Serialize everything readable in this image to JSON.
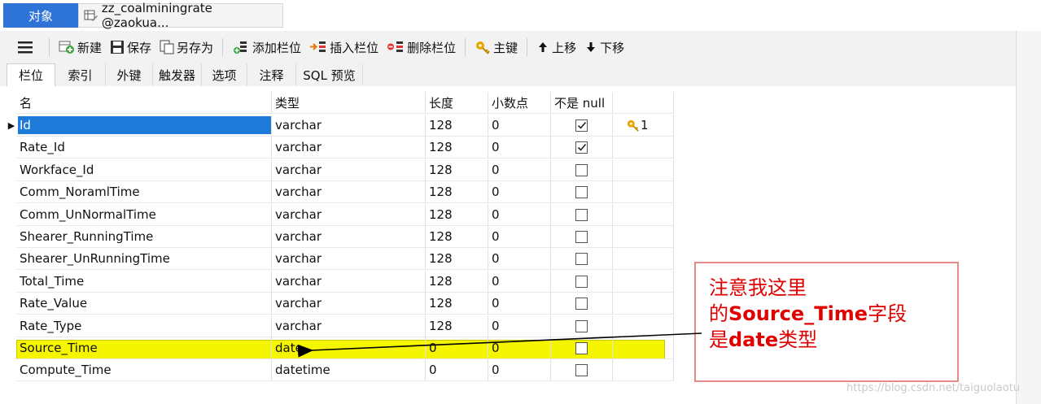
{
  "tabs": {
    "object": "对象",
    "table": "zz_coalminingrate @zaokua..."
  },
  "toolbar": {
    "new": "新建",
    "save": "保存",
    "save_as": "另存为",
    "add_field": "添加栏位",
    "insert_field": "插入栏位",
    "delete_field": "删除栏位",
    "primary_key": "主键",
    "move_up": "上移",
    "move_down": "下移"
  },
  "subtabs": [
    "栏位",
    "索引",
    "外键",
    "触发器",
    "选项",
    "注释",
    "SQL 预览"
  ],
  "columns": {
    "name": "名",
    "type": "类型",
    "length": "长度",
    "decimal": "小数点",
    "not_null": "不是 null"
  },
  "rows": [
    {
      "name": "Id",
      "type": "varchar",
      "length": "128",
      "decimal": "0",
      "not_null": true,
      "key": "1"
    },
    {
      "name": "Rate_Id",
      "type": "varchar",
      "length": "128",
      "decimal": "0",
      "not_null": true,
      "key": ""
    },
    {
      "name": "Workface_Id",
      "type": "varchar",
      "length": "128",
      "decimal": "0",
      "not_null": false,
      "key": ""
    },
    {
      "name": "Comm_NoramlTime",
      "type": "varchar",
      "length": "128",
      "decimal": "0",
      "not_null": false,
      "key": ""
    },
    {
      "name": "Comm_UnNormalTime",
      "type": "varchar",
      "length": "128",
      "decimal": "0",
      "not_null": false,
      "key": ""
    },
    {
      "name": "Shearer_RunningTime",
      "type": "varchar",
      "length": "128",
      "decimal": "0",
      "not_null": false,
      "key": ""
    },
    {
      "name": "Shearer_UnRunningTime",
      "type": "varchar",
      "length": "128",
      "decimal": "0",
      "not_null": false,
      "key": ""
    },
    {
      "name": "Total_Time",
      "type": "varchar",
      "length": "128",
      "decimal": "0",
      "not_null": false,
      "key": ""
    },
    {
      "name": "Rate_Value",
      "type": "varchar",
      "length": "128",
      "decimal": "0",
      "not_null": false,
      "key": ""
    },
    {
      "name": "Rate_Type",
      "type": "varchar",
      "length": "128",
      "decimal": "0",
      "not_null": false,
      "key": ""
    },
    {
      "name": "Source_Time",
      "type": "date",
      "length": "0",
      "decimal": "0",
      "not_null": false,
      "key": ""
    },
    {
      "name": "Compute_Time",
      "type": "datetime",
      "length": "0",
      "decimal": "0",
      "not_null": false,
      "key": ""
    }
  ],
  "annotation": {
    "line1": "注意我这里",
    "line2_prefix": "的",
    "line2_bold": "Source_Time",
    "line2_suffix": "字段",
    "line3_prefix": "是",
    "line3_bold": "date",
    "line3_suffix": "类型"
  },
  "watermark": "https://blog.csdn.net/taiguolaotu",
  "colors": {
    "accent": "#2e74d6",
    "highlight": "#f5f500",
    "note": "#e00000",
    "selected_cell": "#1e7ad8"
  }
}
